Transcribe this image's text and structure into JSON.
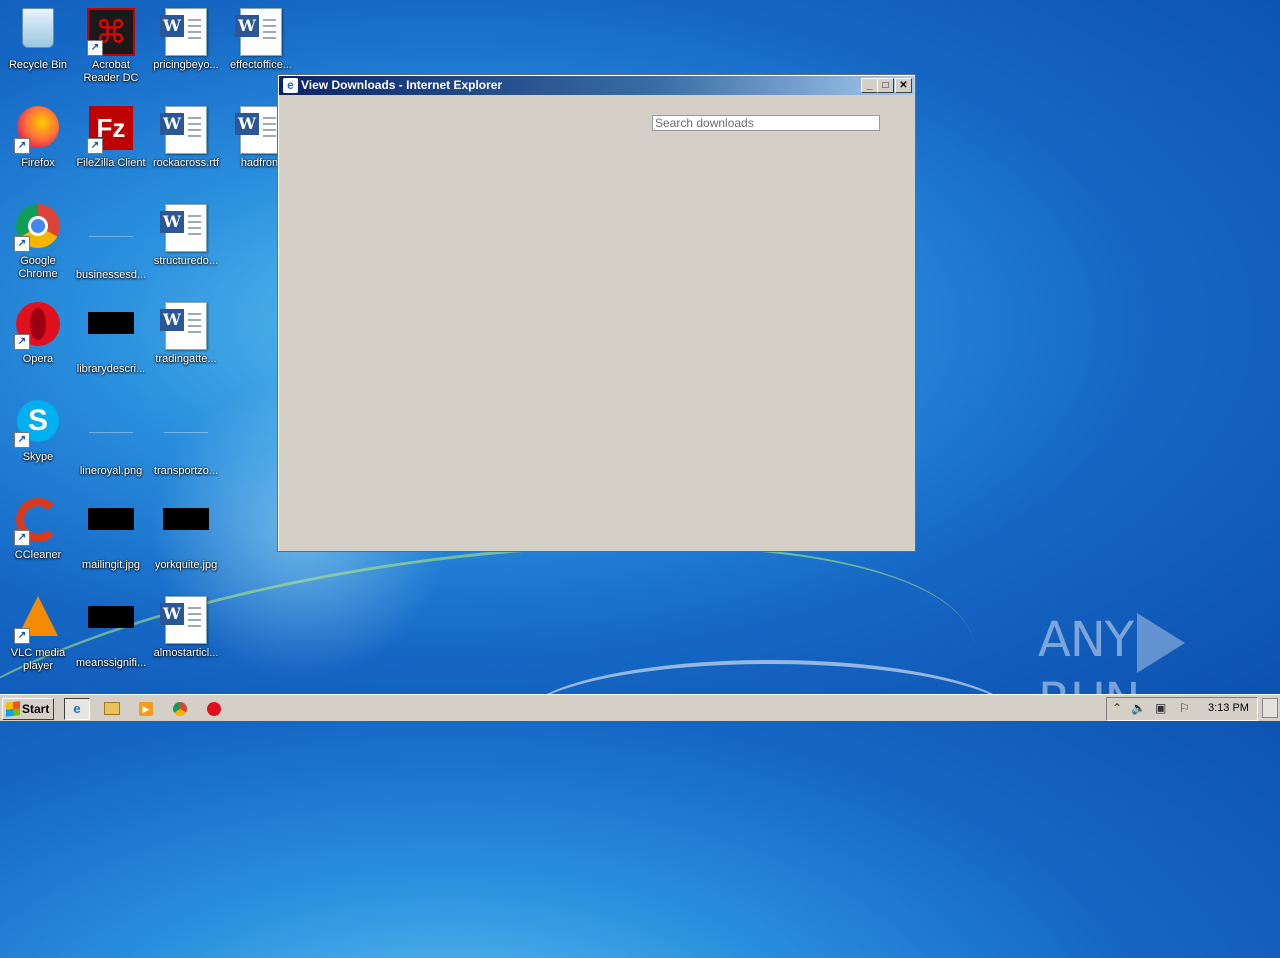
{
  "desktop": {
    "icons": [
      {
        "label": "Recycle Bin",
        "icon": "recycle-bin-icon"
      },
      {
        "label": "Acrobat Reader DC",
        "icon": "acrobat-icon"
      },
      {
        "label": "pricingbeyo...",
        "icon": "word-doc-icon"
      },
      {
        "label": "effectoffice...",
        "icon": "word-doc-icon"
      },
      {
        "label": "Firefox",
        "icon": "firefox-icon"
      },
      {
        "label": "FileZilla Client",
        "icon": "filezilla-icon"
      },
      {
        "label": "rockacross.rtf",
        "icon": "word-doc-icon"
      },
      {
        "label": "hadfront",
        "icon": "word-doc-icon"
      },
      {
        "label": "Google Chrome",
        "icon": "chrome-icon"
      },
      {
        "label": "businessesd...",
        "icon": "blank-file-icon"
      },
      {
        "label": "structuredo...",
        "icon": "word-doc-icon"
      },
      {
        "label": "Opera",
        "icon": "opera-icon"
      },
      {
        "label": "librarydescri...",
        "icon": "image-thumb-icon"
      },
      {
        "label": "tradingatte...",
        "icon": "word-doc-icon"
      },
      {
        "label": "Skype",
        "icon": "skype-icon"
      },
      {
        "label": "lineroyal.png",
        "icon": "blank-file-icon"
      },
      {
        "label": "transportzo...",
        "icon": "blank-file-icon"
      },
      {
        "label": "CCleaner",
        "icon": "ccleaner-icon"
      },
      {
        "label": "mailingit.jpg",
        "icon": "image-thumb-icon"
      },
      {
        "label": "yorkquite.jpg",
        "icon": "image-thumb-icon"
      },
      {
        "label": "VLC media player",
        "icon": "vlc-icon"
      },
      {
        "label": "meanssignifi...",
        "icon": "image-thumb-icon"
      },
      {
        "label": "almostarticl...",
        "icon": "word-doc-icon"
      }
    ]
  },
  "window": {
    "title": "View Downloads - Internet Explorer",
    "search_placeholder": "Search downloads",
    "controls": {
      "minimize": "_",
      "maximize": "□",
      "close": "✕"
    }
  },
  "taskbar": {
    "start_label": "Start",
    "clock": "3:13 PM",
    "pinned": [
      "ie-icon",
      "explorer-icon",
      "media-player-icon",
      "chrome-icon",
      "opera-icon"
    ]
  },
  "watermark": {
    "left": "ANY",
    "right": "RUN"
  }
}
